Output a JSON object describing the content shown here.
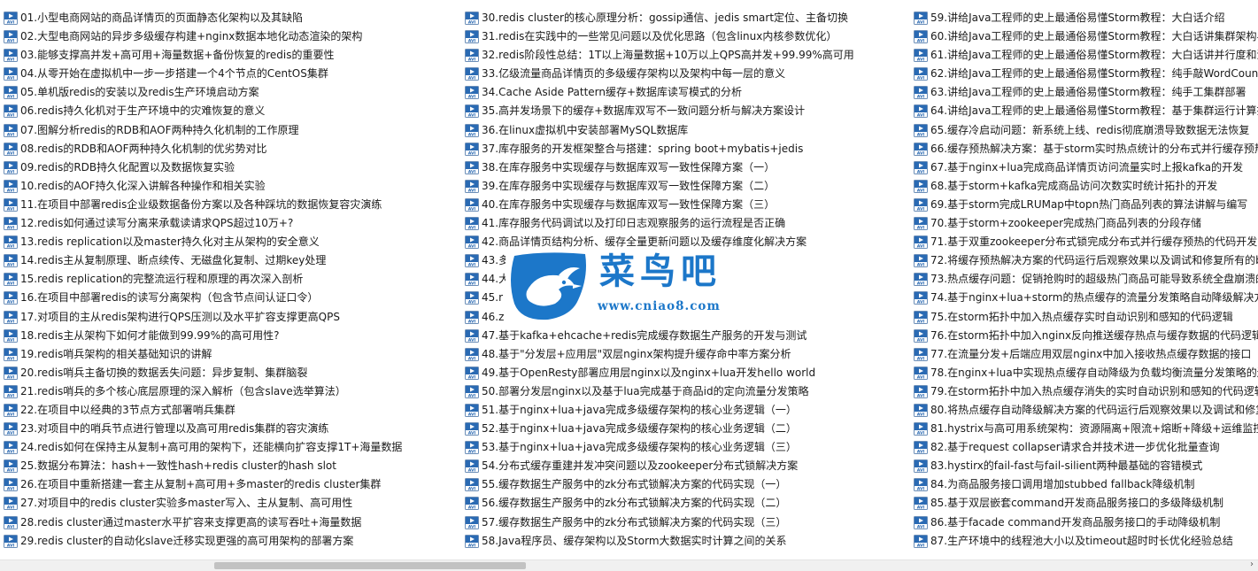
{
  "colors": {
    "text": "#1a1a1a",
    "icon_blue": "#2a6ab3",
    "logo_blue": "#1c77c9",
    "scrollbar_track": "#f0f0f0",
    "scrollbar_thumb": "#c2c2c2"
  },
  "icons": {
    "file": "avi-video-file-icon",
    "scroll_right": "chevron-right-icon"
  },
  "icon_label": "AVI",
  "logo": {
    "title": "菜鸟吧",
    "url": "www.cniao8.com"
  },
  "scrollbar": {
    "arrow": "›"
  },
  "columns": [
    [
      "01.小型电商网站的商品详情页的页面静态化架构以及其缺陷",
      "02.大型电商网站的异步多级缓存构建+nginx数据本地化动态渲染的架构",
      "03.能够支撑高并发+高可用+海量数据+备份恢复的redis的重要性",
      "04.从零开始在虚拟机中一步一步搭建一个4个节点的CentOS集群",
      "05.单机版redis的安装以及redis生产环境启动方案",
      "06.redis持久化机对于生产环境中的灾难恢复的意义",
      "07.图解分析redis的RDB和AOF两种持久化机制的工作原理",
      "08.redis的RDB和AOF两种持久化机制的优劣势对比",
      "09.redis的RDB持久化配置以及数据恢复实验",
      "10.redis的AOF持久化深入讲解各种操作和相关实验",
      "11.在项目中部署redis企业级数据备份方案以及各种踩坑的数据恢复容灾演练",
      "12.redis如何通过读写分离来承载读请求QPS超过10万+?",
      "13.redis replication以及master持久化对主从架构的安全意义",
      "14.redis主从复制原理、断点续传、无磁盘化复制、过期key处理",
      "15.redis replication的完整流运行程和原理的再次深入剖析",
      "16.在项目中部署redis的读写分离架构（包含节点间认证口令）",
      "17.对项目的主从redis架构进行QPS压测以及水平扩容支撑更高QPS",
      "18.redis主从架构下如何才能做到99.99%的高可用性?",
      "19.redis哨兵架构的相关基础知识的讲解",
      "20.redis哨兵主备切换的数据丢失问题：异步复制、集群脑裂",
      "21.redis哨兵的多个核心底层原理的深入解析（包含slave选举算法）",
      "22.在项目中以经典的3节点方式部署哨兵集群",
      "23.对项目中的哨兵节点进行管理以及高可用redis集群的容灾演练",
      "24.redis如何在保持主从复制+高可用的架构下，还能横向扩容支撑1T+海量数据",
      "25.数据分布算法：hash+一致性hash+redis cluster的hash slot",
      "26.在项目中重新搭建一套主从复制+高可用+多master的redis cluster集群",
      "27.对项目中的redis cluster实验多master写入、主从复制、高可用性",
      "28.redis cluster通过master水平扩容来支撑更高的读写吞吐+海量数据",
      "29.redis cluster的自动化slave迁移实现更强的高可用架构的部署方案"
    ],
    [
      "30.redis cluster的核心原理分析：gossip通信、jedis smart定位、主备切换",
      "31.redis在实践中的一些常见问题以及优化思路（包含linux内核参数优化）",
      "32.redis阶段性总结：1T以上海量数据+10万以上QPS高并发+99.99%高可用",
      "33.亿级流量商品详情页的多级缓存架构以及架构中每一层的意义",
      "34.Cache Aside Pattern缓存+数据库读写模式的分析",
      "35.高并发场景下的缓存+数据库双写不一致问题分析与解决方案设计",
      "36.在linux虚拟机中安装部署MySQL数据库",
      "37.库存服务的开发框架整合与搭建：spring boot+mybatis+jedis",
      "38.在库存服务中实现缓存与数据库双写一致性保障方案（一）",
      "39.在库存服务中实现缓存与数据库双写一致性保障方案（二）",
      "40.在库存服务中实现缓存与数据库双写一致性保障方案（三）",
      "41.库存服务代码调试以及打印日志观察服务的运行流程是否正确",
      "42.商品详情页结构分析、缓存全量更新问题以及缓存维度化解决方案",
      "43.多",
      "44.大                                                           缓存",
      "45.r",
      "46.z                                                            介绍",
      "47.基于kafka+ehcache+redis完成缓存数据生产服务的开发与测试",
      "48.基于\"分发层+应用层\"双层nginx架构提升缓存命中率方案分析",
      "49.基于OpenResty部署应用层nginx以及nginx+lua开发hello world",
      "50.部署分发层nginx以及基于lua完成基于商品id的定向流量分发策略",
      "51.基于nginx+lua+java完成多级缓存架构的核心业务逻辑（一）",
      "52.基于nginx+lua+java完成多级缓存架构的核心业务逻辑（二）",
      "53.基于nginx+lua+java完成多级缓存架构的核心业务逻辑（三）",
      "54.分布式缓存重建并发冲突问题以及zookeeper分布式锁解决方案",
      "55.缓存数据生产服务中的zk分布式锁解决方案的代码实现（一）",
      "56.缓存数据生产服务中的zk分布式锁解决方案的代码实现（二）",
      "57.缓存数据生产服务中的zk分布式锁解决方案的代码实现（三）",
      "58.Java程序员、缓存架构以及Storm大数据实时计算之间的关系"
    ],
    [
      "59.讲给Java工程师的史上最通俗易懂Storm教程：大白话介绍",
      "60.讲给Java工程师的史上最通俗易懂Storm教程：大白话讲集群架构与",
      "61.讲给Java工程师的史上最通俗易懂Storm教程：大白话讲并行度和流",
      "62.讲给Java工程师的史上最通俗易懂Storm教程：纯手敲WordCount",
      "63.讲给Java工程师的史上最通俗易懂Storm教程：纯手工集群部署",
      "64.讲给Java工程师的史上最通俗易懂Storm教程：基于集群运行计算拓",
      "65.缓存冷启动问题：新系统上线、redis彻底崩溃导致数据无法恢复",
      "66.缓存预热解决方案：基于storm实时热点统计的分布式并行缓存预热",
      "67.基于nginx+lua完成商品详情页访问流量实时上报kafka的开发",
      "68.基于storm+kafka完成商品访问次数实时统计拓扑的开发",
      "69.基于storm完成LRUMap中topn热门商品列表的算法讲解与编写",
      "70.基于storm+zookeeper完成热门商品列表的分段存储",
      "71.基于双重zookeeper分布式锁完成分布式并行缓存预热的代码开发",
      "72.将缓存预热解决方案的代码运行后观察效果以及调试和修复所有的b",
      "73.热点缓存问题：促销抢购时的超级热门商品可能导致系统全盘崩溃的",
      "74.基于nginx+lua+storm的热点缓存的流量分发策略自动降级解决方",
      "75.在storm拓扑中加入热点缓存实时自动识别和感知的代码逻辑",
      "76.在storm拓扑中加入nginx反向推送缓存热点与缓存数据的代码逻辑",
      "77.在流量分发+后端应用双层nginx中加入接收热点缓存数据的接口",
      "78.在nginx+lua中实现热点缓存自动降级为负载均衡流量分发策略的逻",
      "79.在storm拓扑中加入热点缓存消失的实时自动识别和感知的代码逻辑",
      "80.将热点缓存自动降级解决方案的代码运行后观察效果以及调试和修复",
      "81.hystrix与高可用系统架构：资源隔离+限流+熔断+降级+运维监控",
      "82.基于request collapser请求合并技术进一步优化批量查询",
      "83.hystirx的fail-fast与fail-silient两种最基础的容错模式",
      "84.为商品服务接口调用增加stubbed fallback降级机制",
      "85.基于双层嵌套command开发商品服务接口的多级降级机制",
      "86.基于facade command开发商品服务接口的手动降级机制",
      "87.生产环境中的线程池大小以及timeout超时时长优化经验总结"
    ]
  ]
}
